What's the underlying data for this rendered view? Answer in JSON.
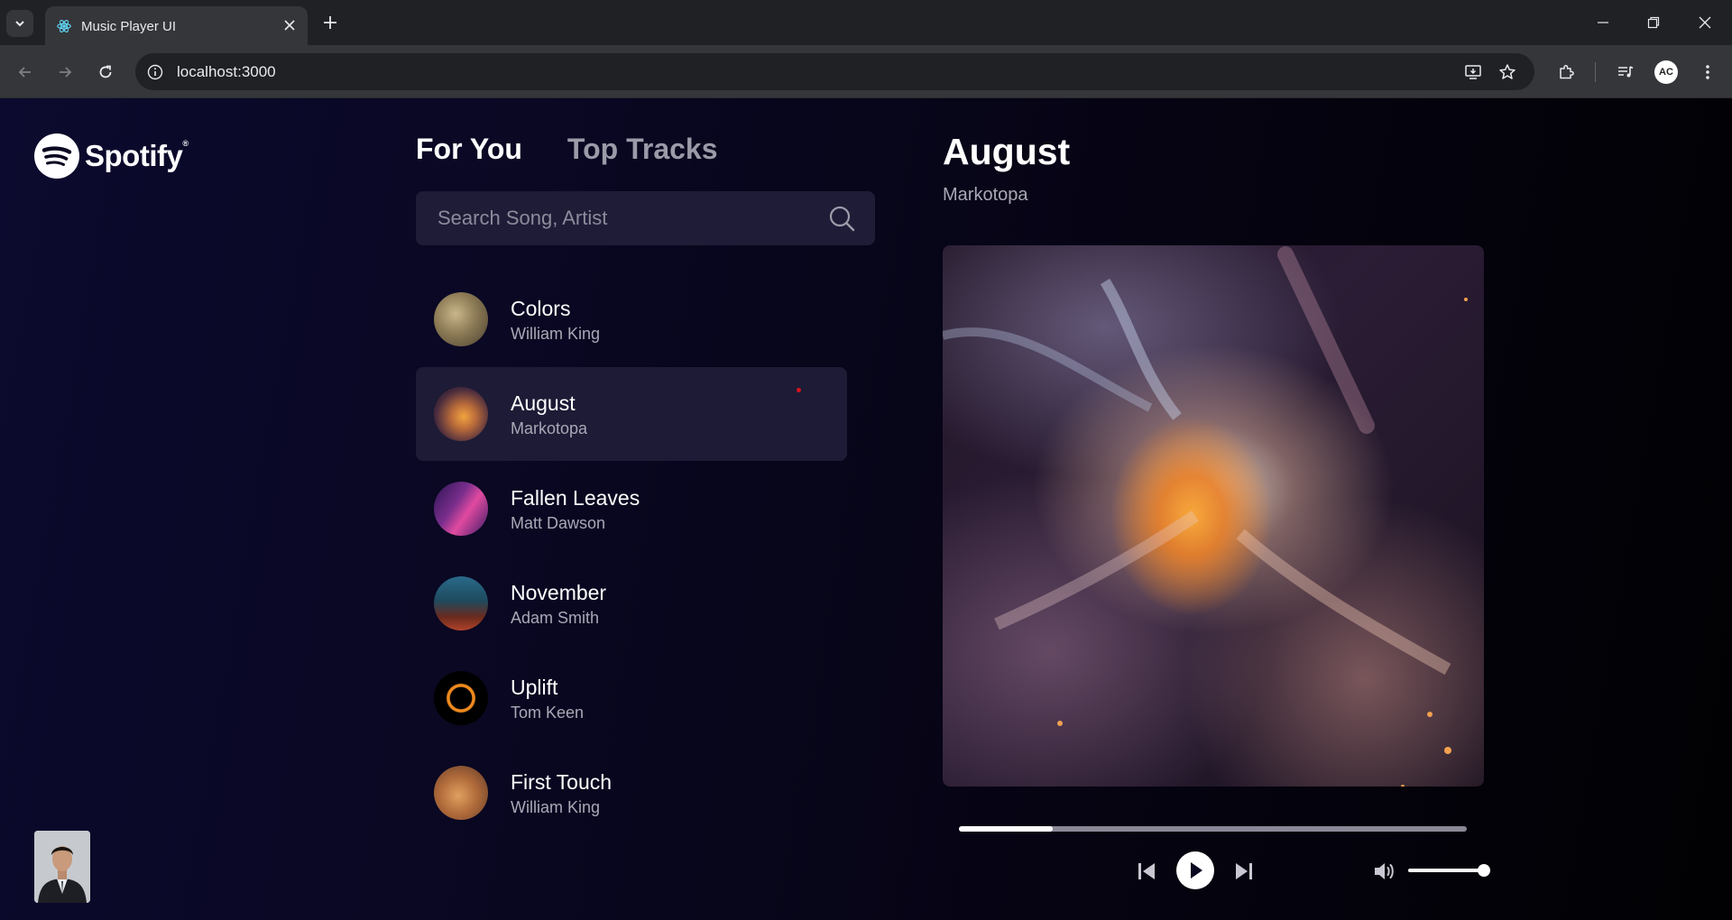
{
  "browser": {
    "tab_title": "Music Player UI",
    "url": "localhost:3000",
    "profile_initials": "AC"
  },
  "app": {
    "brand": "Spotify",
    "brand_mark": "®",
    "tabs": [
      {
        "label": "For You",
        "active": true
      },
      {
        "label": "Top Tracks",
        "active": false
      }
    ],
    "search": {
      "placeholder": "Search Song, Artist",
      "value": ""
    },
    "songs": [
      {
        "title": "Colors",
        "artist": "William King",
        "active": false
      },
      {
        "title": "August",
        "artist": "Markotopa",
        "active": true
      },
      {
        "title": "Fallen Leaves",
        "artist": "Matt Dawson",
        "active": false
      },
      {
        "title": "November",
        "artist": "Adam Smith",
        "active": false
      },
      {
        "title": "Uplift",
        "artist": "Tom Keen",
        "active": false
      },
      {
        "title": "First Touch",
        "artist": "William King",
        "active": false
      }
    ],
    "now_playing": {
      "title": "August",
      "artist": "Markotopa",
      "progress": 0.185,
      "volume": 1.0,
      "playing": false
    },
    "colors": {
      "background_start": "#0c0a2e",
      "background_end": "#010103",
      "active_row": "#1d1b35",
      "accent_dot": "#d4141e"
    }
  }
}
